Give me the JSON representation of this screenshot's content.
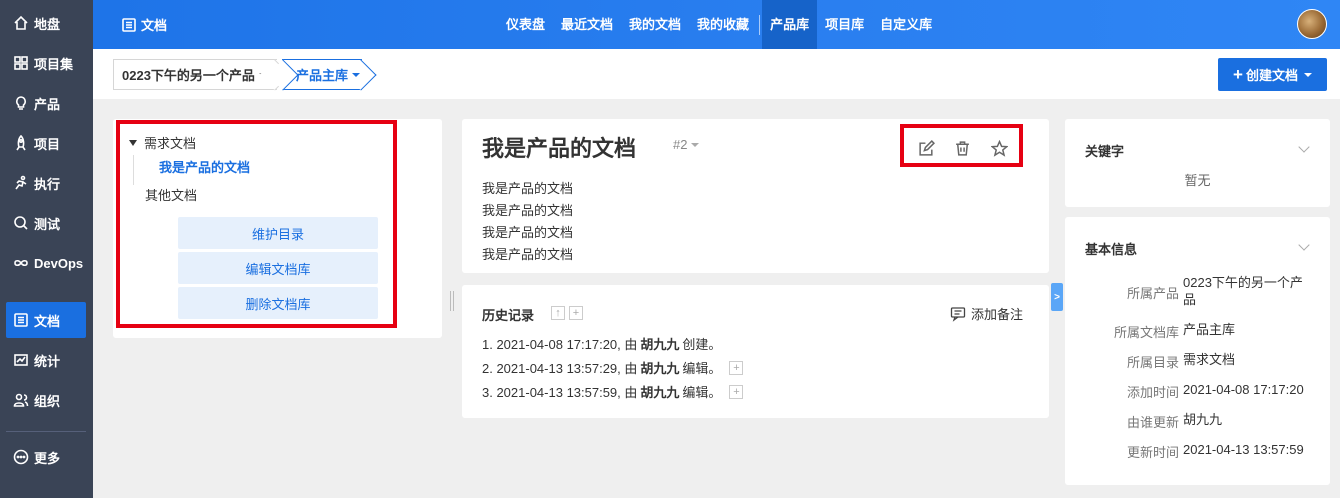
{
  "sidebar": {
    "items": [
      {
        "label": "地盘",
        "icon": "home-icon"
      },
      {
        "label": "项目集",
        "icon": "grid-icon"
      },
      {
        "label": "产品",
        "icon": "bulb-icon"
      },
      {
        "label": "项目",
        "icon": "rocket-icon"
      },
      {
        "label": "执行",
        "icon": "run-icon"
      },
      {
        "label": "测试",
        "icon": "search-icon"
      },
      {
        "label": "DevOps",
        "icon": "infinity-icon"
      },
      {
        "label": "文档",
        "icon": "list-icon"
      },
      {
        "label": "统计",
        "icon": "chart-icon"
      },
      {
        "label": "组织",
        "icon": "users-icon"
      },
      {
        "label": "更多",
        "icon": "more-icon"
      }
    ],
    "active": "文档"
  },
  "topbar": {
    "app_title": "文档",
    "nav": [
      "仪表盘",
      "最近文档",
      "我的文档",
      "我的收藏",
      "产品库",
      "项目库",
      "自定义库"
    ],
    "active_nav": "产品库"
  },
  "breadcrumb": {
    "product": "0223下午的另一个产品",
    "library": "产品主库"
  },
  "create_button": "创建文档",
  "tree": {
    "root": "需求文档",
    "child": "我是产品的文档",
    "other": "其他文档",
    "buttons": [
      "维护目录",
      "编辑文档库",
      "删除文档库"
    ]
  },
  "doc": {
    "title": "我是产品的文档",
    "version": "#2",
    "lines": [
      "我是产品的文档",
      "我是产品的文档",
      "我是产品的文档",
      "我是产品的文档"
    ]
  },
  "history": {
    "title": "历史记录",
    "add_note": "添加备注",
    "rows": [
      {
        "prefix": "1. 2021-04-08 17:17:20, 由",
        "user": "胡九九",
        "action": "创建。"
      },
      {
        "prefix": "2. 2021-04-13 13:57:29, 由",
        "user": "胡九九",
        "action": "编辑。"
      },
      {
        "prefix": "3. 2021-04-13 13:57:59, 由",
        "user": "胡九九",
        "action": "编辑。"
      }
    ]
  },
  "keywords": {
    "title": "关键字",
    "empty": "暂无"
  },
  "basic_info": {
    "title": "基本信息",
    "rows": [
      {
        "label": "所属产品",
        "value": "0223下午的另一个产品"
      },
      {
        "label": "所属文档库",
        "value": "产品主库"
      },
      {
        "label": "所属目录",
        "value": "需求文档"
      },
      {
        "label": "添加时间",
        "value": "2021-04-08 17:17:20"
      },
      {
        "label": "由谁更新",
        "value": "胡九九"
      },
      {
        "label": "更新时间",
        "value": "2021-04-13 13:57:59"
      }
    ]
  },
  "colors": {
    "primary": "#1a6fe0",
    "sidebar": "#3a4456",
    "highlight_box": "#e60012"
  }
}
